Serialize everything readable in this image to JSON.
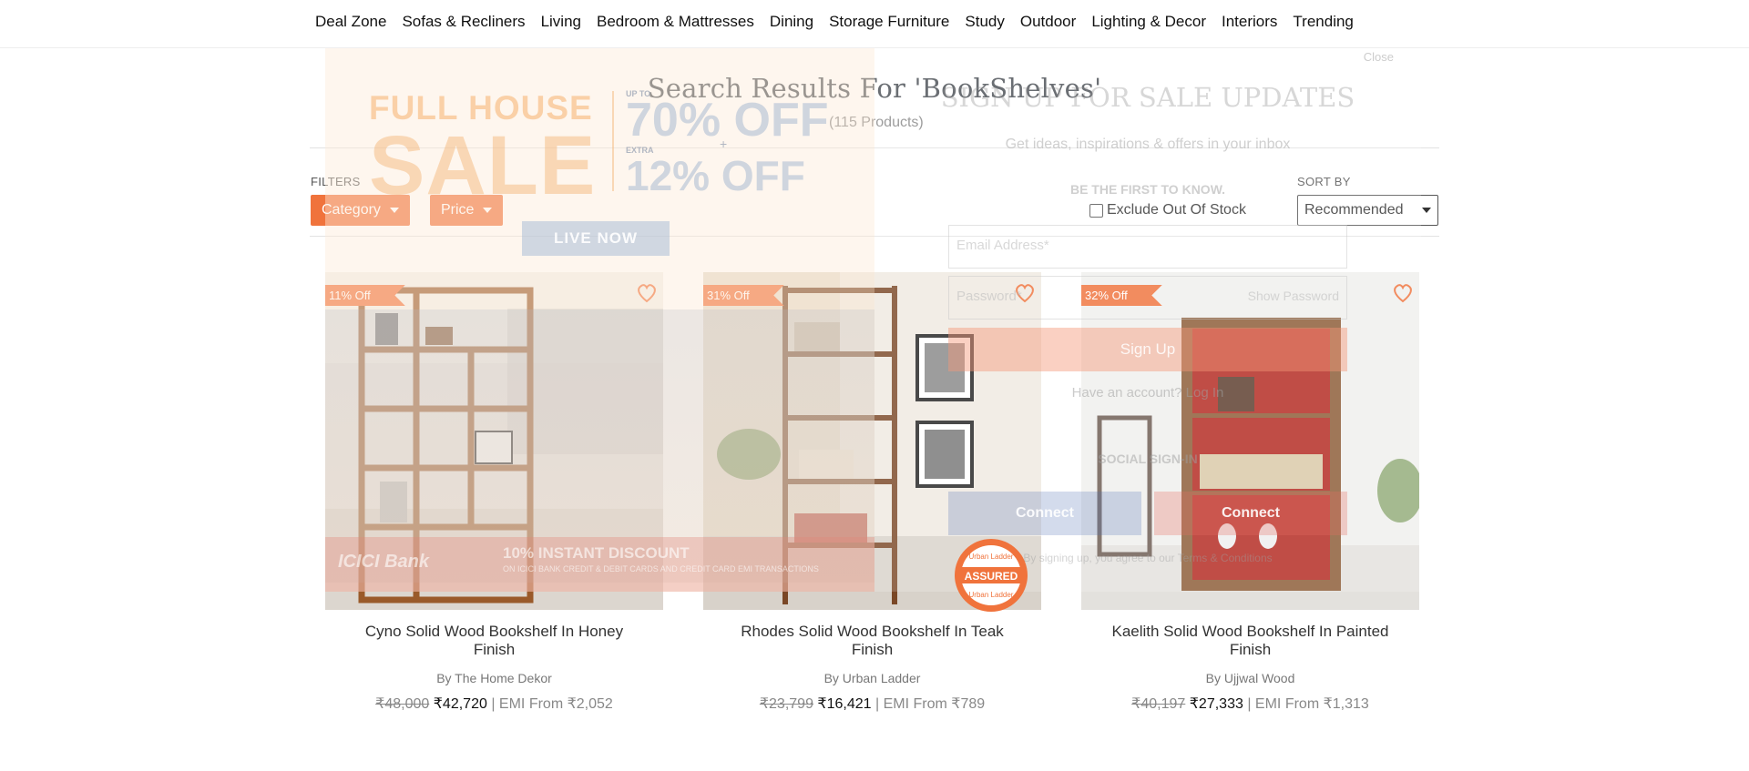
{
  "nav": {
    "items": [
      "Deal Zone",
      "Sofas & Recliners",
      "Living",
      "Bedroom & Mattresses",
      "Dining",
      "Storage Furniture",
      "Study",
      "Outdoor",
      "Lighting & Decor",
      "Interiors",
      "Trending"
    ]
  },
  "results": {
    "title": "Search Results For 'BookShelves'",
    "count": "(115 Products)"
  },
  "filters": {
    "label": "FILTERS",
    "category": "Category",
    "price": "Price",
    "exclude_out_of_stock": "Exclude Out Of Stock"
  },
  "sort": {
    "label": "SORT BY",
    "selected": "Recommended"
  },
  "products": [
    {
      "badge": "11% Off",
      "name": "Cyno Solid Wood Bookshelf In Honey Finish",
      "brand": "By The Home Dekor",
      "mrp": "₹48,000",
      "price": "₹42,720",
      "emi": "| EMI From ₹2,052"
    },
    {
      "badge": "31% Off",
      "name": "Rhodes Solid Wood Bookshelf In Teak Finish",
      "brand": "By Urban Ladder",
      "mrp": "₹23,799",
      "price": "₹16,421",
      "emi": "| EMI From ₹789"
    },
    {
      "badge": "32% Off",
      "name": "Kaelith Solid Wood Bookshelf In Painted Finish",
      "brand": "By Ujjwal Wood",
      "mrp": "₹40,197",
      "price": "₹27,333",
      "emi": "| EMI From ₹1,313"
    }
  ],
  "promo": {
    "full_house": "FULL HOUSE",
    "sale": "SALE",
    "up_to": "UP TO",
    "off_70": "70% OFF",
    "extra": "EXTRA",
    "plus": "+",
    "off_12": "12% OFF",
    "live_now": "LIVE NOW",
    "bank": "ICICI Bank",
    "instant_discount": "10% INSTANT DISCOUNT",
    "bank_sub": "ON ICICI BANK CREDIT & DEBIT CARDS AND CREDIT CARD EMI TRANSACTIONS"
  },
  "signup": {
    "close": "Close",
    "heading": "SIGN UP FOR SALE UPDATES",
    "subheading": "Get ideas, inspirations & offers in your inbox",
    "first_to_know": "BE THE FIRST TO KNOW.",
    "email_placeholder": "Email Address*",
    "password_placeholder": "Password*",
    "show_password": "Show Password",
    "sign_up": "Sign Up",
    "have_account": "Have an account? Log In",
    "social": "SOCIAL SIGN-IN",
    "facebook": "Connect",
    "google": "Connect",
    "agree": "By signing up, you agree to our Terms & Conditions"
  },
  "assured": {
    "top": "Urban Ladder",
    "middle": "ASSURED",
    "bottom": "Urban Ladder"
  },
  "colors": {
    "accent": "#f0733c"
  }
}
